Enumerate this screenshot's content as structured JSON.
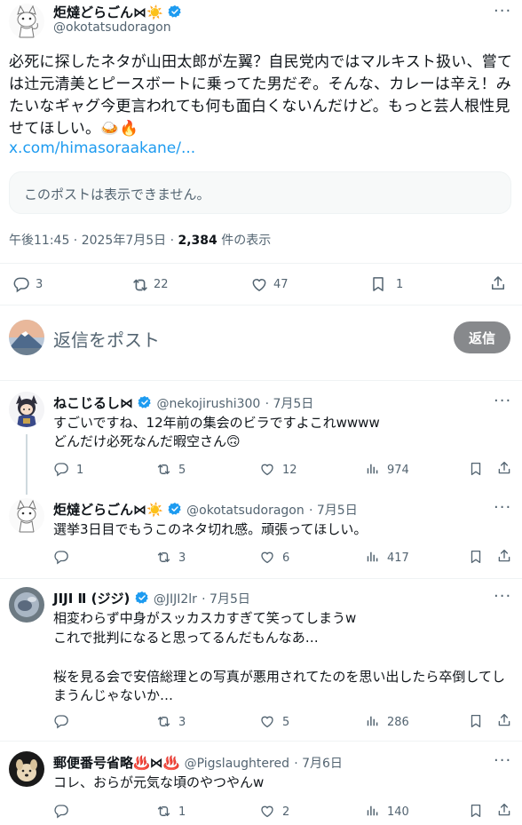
{
  "main_post": {
    "author_name": "炬燵どらごん",
    "author_badges": "⋈☀️",
    "author_handle": "@okotatsudoragon",
    "text": "必死に探したネタが山田太郎が左翼？自民党内ではマルキスト扱い、嘗ては辻元清美とピースボートに乗ってた男だぞ。そんな、カレーは辛え！みたいなギャグ今更言われても何も面白くないんだけど。もっと芸人根性見せてほしい。",
    "text_emoji": "🍛🔥",
    "link": "x.com/himasoraakane/...",
    "quote_unavailable": "このポストは表示できません。",
    "timestamp": "午後11:45 · 2025年7月5日 · ",
    "views_count": "2,384",
    "views_label": " 件の表示",
    "stats": {
      "replies": "3",
      "reposts": "22",
      "likes": "47",
      "bookmarks": "1"
    }
  },
  "reply_composer": {
    "placeholder": "返信をポスト",
    "button_label": "返信"
  },
  "replies": [
    {
      "name": "ねこじるし",
      "badges": "⋈",
      "handle": "@nekojirushi300",
      "date": "· 7月5日",
      "lines": [
        "すごいですね、12年前の集会のビラですよこれwwww",
        "どんだけ必死なんだ暇空さん🙃"
      ],
      "replies": "1",
      "reposts": "5",
      "likes": "12",
      "views": "974"
    },
    {
      "name": "炬燵どらごん",
      "badges": "⋈☀️",
      "handle": "@okotatsudoragon",
      "date": "· 7月5日",
      "lines": [
        "選挙3日目でもうこのネタ切れ感。頑張ってほしい。"
      ],
      "replies": "",
      "reposts": "3",
      "likes": "6",
      "views": "417"
    },
    {
      "name": "JIJI Ⅱ (ジジ)",
      "badges": "",
      "handle": "@JIJI2lr",
      "date": "· 7月5日",
      "lines": [
        "相変わらず中身がスッカスカすぎて笑ってしまうw",
        "これで批判になると思ってるんだもんなあ…",
        "",
        "桜を見る会で安倍総理との写真が悪用されてたのを思い出したら卒倒してし",
        "まうんじゃないか…"
      ],
      "replies": "",
      "reposts": "3",
      "likes": "5",
      "views": "286"
    },
    {
      "name": "郵便番号省略♨️⋈♨️",
      "badges": "",
      "handle": "@Pigslaughtered",
      "date": "· 7月6日",
      "lines": [
        "コレ、おらが元気な頃のやつやんw"
      ],
      "replies": "",
      "reposts": "1",
      "likes": "2",
      "views": "140"
    }
  ],
  "colors": {
    "verified_blue": "#1d9bf0",
    "link_blue": "#1d9bf0",
    "text_gray": "#536471",
    "reply_button_gray": "#87898c"
  }
}
